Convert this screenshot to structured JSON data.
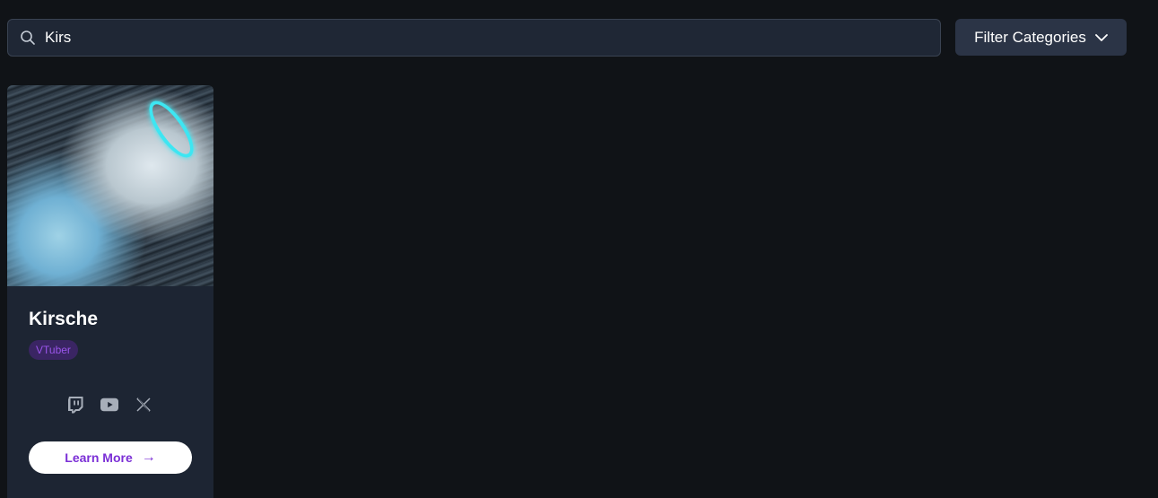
{
  "search": {
    "value": "Kirs",
    "icon": "search-icon"
  },
  "filter": {
    "label": "Filter Categories",
    "icon": "chevron-down-icon"
  },
  "results": [
    {
      "name": "Kirsche",
      "badge": "VTuber",
      "socials": [
        "twitch-icon",
        "youtube-icon",
        "x-icon"
      ],
      "cta_label": "Learn More",
      "cta_arrow": "→"
    }
  ],
  "colors": {
    "background": "#101317",
    "card": "#1d2533",
    "badge_bg": "#3a2563",
    "badge_text": "#9a55ea",
    "accent": "#7b2fd6"
  }
}
